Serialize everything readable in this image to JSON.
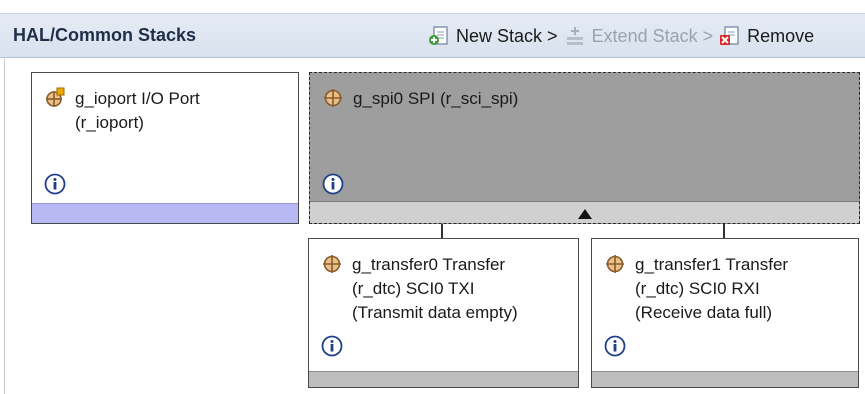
{
  "header": {
    "title": "HAL/Common Stacks",
    "new_stack": "New Stack >",
    "extend_stack": "Extend Stack >",
    "remove": "Remove"
  },
  "modules": {
    "ioport": {
      "line1": "g_ioport I/O Port",
      "line2": "(r_ioport)"
    },
    "spi": {
      "line1": "g_spi0 SPI (r_sci_spi)"
    },
    "transfer0": {
      "line1": "g_transfer0 Transfer",
      "line2": "(r_dtc) SCI0 TXI",
      "line3": "(Transmit data empty)"
    },
    "transfer1": {
      "line1": "g_transfer1 Transfer",
      "line2": "(r_dtc) SCI0 RXI",
      "line3": "(Receive data full)"
    }
  },
  "colors": {
    "header_bg": "#dde5f0",
    "selected_module_bg": "#9e9e9e",
    "ioport_footer": "#b8b8f4",
    "module_footer": "#bdbdbd"
  },
  "icons": {
    "new_stack": "new-stack-icon",
    "extend_stack": "extend-stack-icon",
    "remove": "remove-icon",
    "ioport": "ioport-module-icon",
    "module": "module-icon",
    "info": "info-icon"
  }
}
